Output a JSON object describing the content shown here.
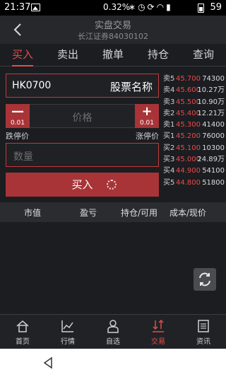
{
  "status_bar": {
    "time": "21:37",
    "net_speed": "0.32%",
    "battery": "59",
    "icons": [
      "image-icon",
      "bluetooth-icon",
      "alarm-icon",
      "sync-icon",
      "wifi-icon",
      "signal-icon",
      "battery-icon"
    ]
  },
  "header": {
    "title": "实盘交易",
    "subtitle": "长江证券84030102"
  },
  "tabs": [
    {
      "label": "买入",
      "active": true
    },
    {
      "label": "卖出",
      "active": false
    },
    {
      "label": "撤单",
      "active": false
    },
    {
      "label": "持仓",
      "active": false
    },
    {
      "label": "查询",
      "active": false
    }
  ],
  "form": {
    "stock_code": "HK0700",
    "stock_name_label": "股票名称",
    "price_placeholder": "价格",
    "minus_sign": "—",
    "plus_sign": "+",
    "step_down": "0.01",
    "step_up": "0.01",
    "limit_down_label": "跌停价",
    "limit_up_label": "涨停价",
    "qty_placeholder": "数量",
    "buy_button": "买入"
  },
  "order_book": [
    {
      "label": "卖5",
      "price": "45.700",
      "volume": "74300"
    },
    {
      "label": "卖4",
      "price": "45.600",
      "volume": "10.27万"
    },
    {
      "label": "卖3",
      "price": "45.500",
      "volume": "10.90万"
    },
    {
      "label": "卖2",
      "price": "45.400",
      "volume": "12.21万"
    },
    {
      "label": "卖1",
      "price": "45.300",
      "volume": "41400"
    },
    {
      "label": "买1",
      "price": "45.200",
      "volume": "76000"
    },
    {
      "label": "买2",
      "price": "45.100",
      "volume": "10300"
    },
    {
      "label": "买3",
      "price": "45.000",
      "volume": "24.89万"
    },
    {
      "label": "买4",
      "price": "44.900",
      "volume": "54100"
    },
    {
      "label": "买5",
      "price": "44.800",
      "volume": "51800"
    }
  ],
  "positions_header": {
    "col1": "市值",
    "col2": "盈亏",
    "col3": "持仓/可用",
    "col4": "成本/现价"
  },
  "bottom_nav": [
    {
      "label": "首页",
      "icon": "home-icon",
      "active": false
    },
    {
      "label": "行情",
      "icon": "chart-icon",
      "active": false
    },
    {
      "label": "自选",
      "icon": "user-icon",
      "active": false
    },
    {
      "label": "交易",
      "icon": "trade-icon",
      "active": true
    },
    {
      "label": "资讯",
      "icon": "news-icon",
      "active": false
    }
  ],
  "colors": {
    "accent": "#e84b4b",
    "button_red": "#a83438",
    "background": "#1b1d21"
  }
}
